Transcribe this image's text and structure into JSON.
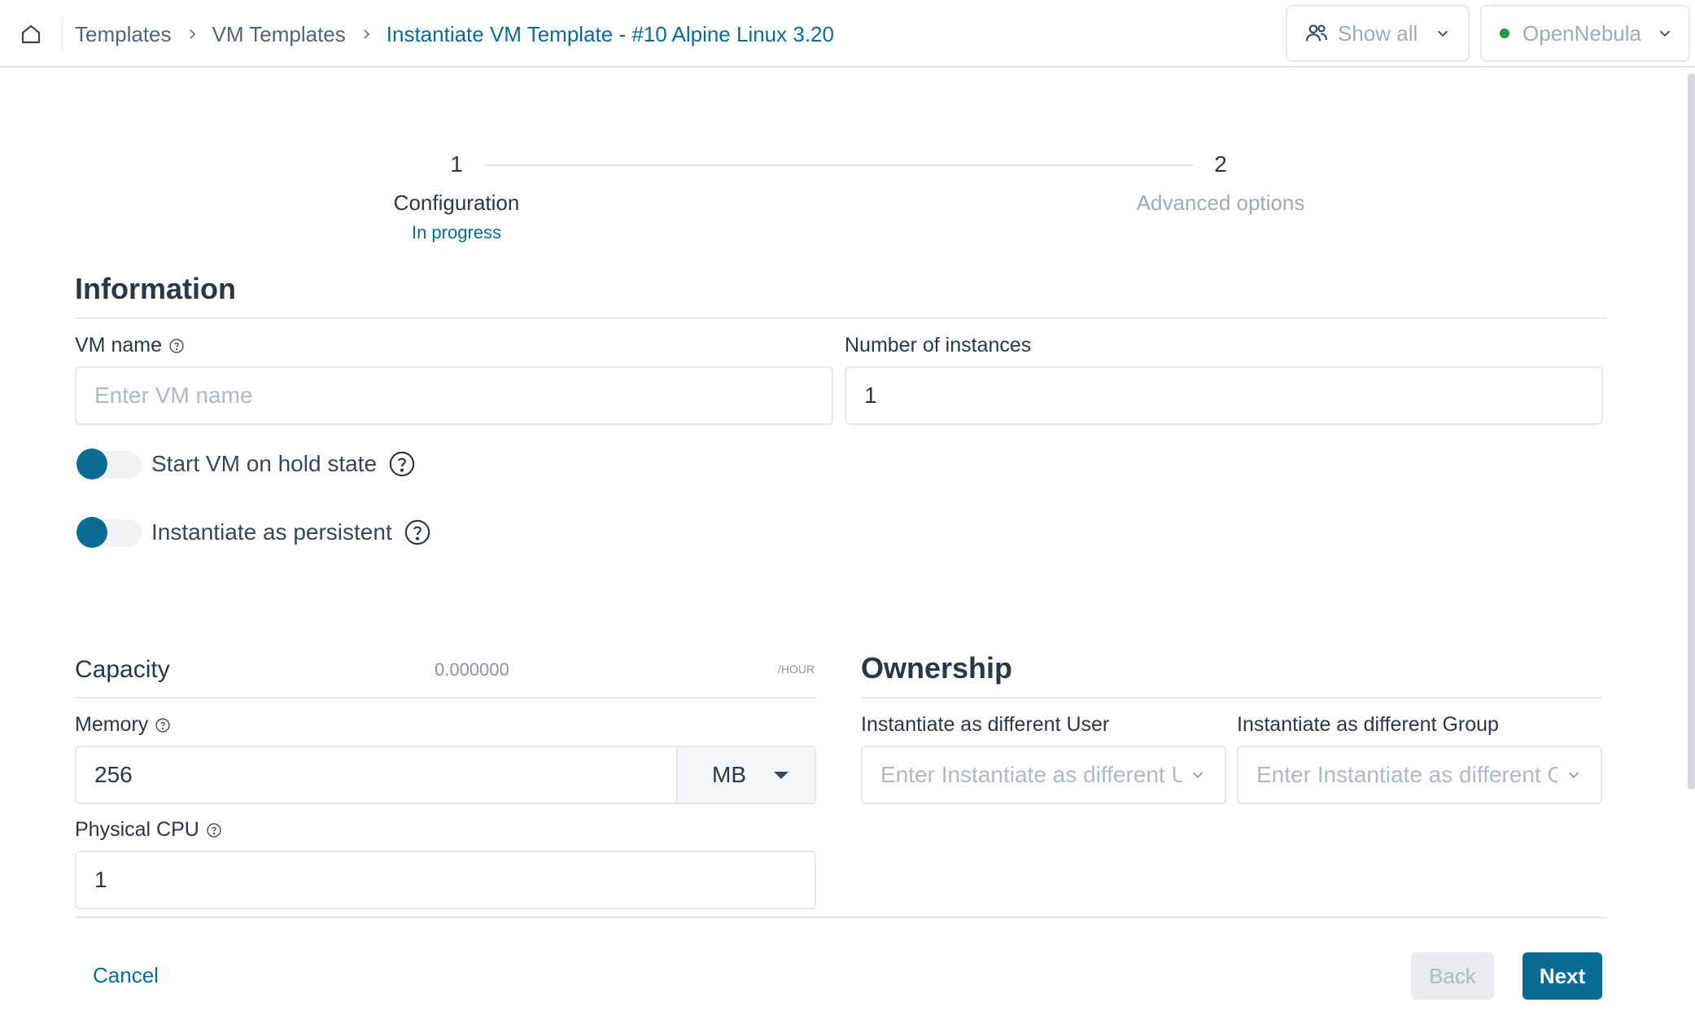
{
  "header": {
    "breadcrumb": [
      "Templates",
      "VM Templates",
      "Instantiate VM Template - #10 Alpine Linux 3.20"
    ],
    "group_filter": "Show all",
    "zone": "OpenNebula",
    "zone_status_color": "#1a9b3c"
  },
  "stepper": {
    "steps": [
      {
        "number": "1",
        "label": "Configuration",
        "status": "In progress"
      },
      {
        "number": "2",
        "label": "Advanced options"
      }
    ]
  },
  "information": {
    "title": "Information",
    "vm_name_label": "VM name",
    "vm_name_placeholder": "Enter VM name",
    "instances_label": "Number of instances",
    "instances_value": "1",
    "hold_label": "Start VM on hold state",
    "persistent_label": "Instantiate as persistent"
  },
  "capacity": {
    "title": "Capacity",
    "cost": "0.000000",
    "cost_unit": "/HOUR",
    "memory_label": "Memory",
    "memory_value": "256",
    "memory_unit": "MB",
    "cpu_label": "Physical CPU",
    "cpu_value": "1"
  },
  "ownership": {
    "title": "Ownership",
    "user_label": "Instantiate as different User",
    "user_placeholder": "Enter Instantiate as different User",
    "group_label": "Instantiate as different Group",
    "group_placeholder": "Enter Instantiate as different Group"
  },
  "footer": {
    "cancel": "Cancel",
    "back": "Back",
    "next": "Next"
  },
  "colors": {
    "accent": "#0c6b94",
    "border": "#e6e8ec",
    "placeholder": "#b3b8c0"
  }
}
